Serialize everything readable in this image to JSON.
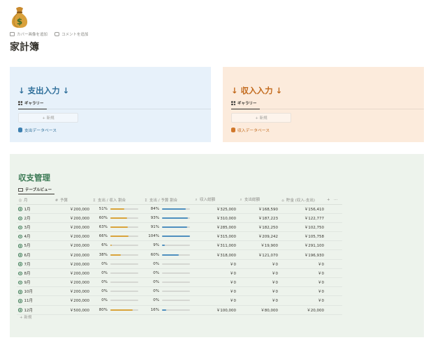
{
  "page": {
    "icon": "money-bag-icon",
    "add_cover": "カバー画像を追加",
    "add_comment": "コメントを追加",
    "title": "家計簿"
  },
  "expense_card": {
    "title": "↓ 支出入力 ↓",
    "view_tab": "ギャラリー",
    "new_label": "+ 新規",
    "db_link": "支出データベース"
  },
  "income_card": {
    "title": "↓ 収入入力 ↓",
    "view_tab": "ギャラリー",
    "new_label": "+ 新規",
    "db_link": "収入データベース"
  },
  "balance": {
    "title": "収支管理",
    "view_tab": "テーブルビュー",
    "columns": {
      "month": "月",
      "budget": "予算",
      "expense_income_ratio": "支出 / 収入 割合",
      "expense_budget_ratio": "支出 / 予算 割合",
      "income_total": "収入総額",
      "expense_total": "支出総額",
      "savings": "貯金 (収入-支出)"
    },
    "add_column": "+",
    "more": "···",
    "rows": [
      {
        "month": "1月",
        "budget": "￥200,000",
        "ei_label": "51%",
        "ei": 0.51,
        "eb_label": "84%",
        "eb": 0.84,
        "income": "￥325,000",
        "expense": "￥168,590",
        "savings": "￥156,410"
      },
      {
        "month": "2月",
        "budget": "￥200,000",
        "ei_label": "60%",
        "ei": 0.6,
        "eb_label": "93%",
        "eb": 0.93,
        "income": "￥310,000",
        "expense": "￥187,223",
        "savings": "￥122,777"
      },
      {
        "month": "3月",
        "budget": "￥200,000",
        "ei_label": "63%",
        "ei": 0.63,
        "eb_label": "91%",
        "eb": 0.91,
        "income": "￥285,000",
        "expense": "￥182,250",
        "savings": "￥102,750"
      },
      {
        "month": "4月",
        "budget": "￥200,000",
        "ei_label": "66%",
        "ei": 0.66,
        "eb_label": "104%",
        "eb": 1.0,
        "income": "￥315,000",
        "expense": "￥209,242",
        "savings": "￥105,758"
      },
      {
        "month": "5月",
        "budget": "￥200,000",
        "ei_label": "6%",
        "ei": 0.06,
        "eb_label": "9%",
        "eb": 0.09,
        "income": "￥311,000",
        "expense": "￥19,900",
        "savings": "￥291,100"
      },
      {
        "month": "6月",
        "budget": "￥200,000",
        "ei_label": "38%",
        "ei": 0.38,
        "eb_label": "60%",
        "eb": 0.6,
        "income": "￥318,000",
        "expense": "￥121,070",
        "savings": "￥196,930"
      },
      {
        "month": "7月",
        "budget": "￥200,000",
        "ei_label": "0%",
        "ei": 0,
        "eb_label": "0%",
        "eb": 0,
        "income": "￥0",
        "expense": "￥0",
        "savings": "￥0"
      },
      {
        "month": "8月",
        "budget": "￥200,000",
        "ei_label": "0%",
        "ei": 0,
        "eb_label": "0%",
        "eb": 0,
        "income": "￥0",
        "expense": "￥0",
        "savings": "￥0"
      },
      {
        "month": "9月",
        "budget": "￥200,000",
        "ei_label": "0%",
        "ei": 0,
        "eb_label": "0%",
        "eb": 0,
        "income": "￥0",
        "expense": "￥0",
        "savings": "￥0"
      },
      {
        "month": "10月",
        "budget": "￥200,000",
        "ei_label": "0%",
        "ei": 0,
        "eb_label": "0%",
        "eb": 0,
        "income": "￥0",
        "expense": "￥0",
        "savings": "￥0"
      },
      {
        "month": "11月",
        "budget": "￥200,000",
        "ei_label": "0%",
        "ei": 0,
        "eb_label": "0%",
        "eb": 0,
        "income": "￥0",
        "expense": "￥0",
        "savings": "￥0"
      },
      {
        "month": "12月",
        "budget": "￥500,000",
        "ei_label": "80%",
        "ei": 0.8,
        "eb_label": "16%",
        "eb": 0.16,
        "income": "￥100,000",
        "expense": "￥80,000",
        "savings": "￥20,000"
      }
    ],
    "new_row": "+ 新規"
  },
  "colors": {
    "blue_card": "#e7f1fa",
    "orange_card": "#fcebdc",
    "green_card": "#edf3ec",
    "bar_orange": "#d9a33a",
    "bar_blue": "#4e8fbf"
  }
}
